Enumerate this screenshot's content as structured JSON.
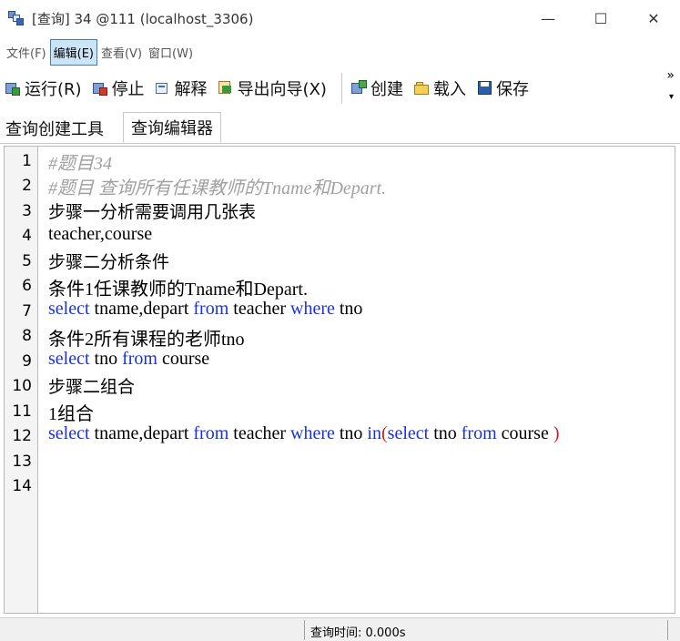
{
  "window": {
    "title": "[查询] 34 @111 (localhost_3306)",
    "minimize": "—",
    "maximize": "☐",
    "close": "✕"
  },
  "menu": {
    "file": "文件(F)",
    "edit": "编辑(E)",
    "view": "查看(V)",
    "window": "窗口(W)"
  },
  "toolbar": {
    "run": "运行(R)",
    "stop": "停止",
    "explain": "解释",
    "export_wizard": "导出向导(X)",
    "create": "创建",
    "load": "载入",
    "save": "保存",
    "overflow": "»",
    "dropdown": "▾"
  },
  "tabs": {
    "query_builder": "查询创建工具",
    "query_editor": "查询编辑器"
  },
  "editor": {
    "line_numbers": [
      "1",
      "2",
      "3",
      "4",
      "5",
      "6",
      "7",
      "8",
      "9",
      "10",
      "11",
      "12",
      "13",
      "14"
    ],
    "lines": {
      "l1": "#题目34",
      "l2": "#题目 查询所有任课教师的Tname和Depart.",
      "l3": "步骤一分析需要调用几张表",
      "l4": "teacher,course",
      "l5": "步骤二分析条件",
      "l6": "条件1任课教师的Tname和Depart.",
      "l7": {
        "k1": "select",
        "t1": " tname,depart ",
        "k2": "from",
        "t2": " teacher ",
        "k3": "where",
        "t3": " tno"
      },
      "l8": "条件2所有课程的老师tno",
      "l9": {
        "k1": "select",
        "t1": " tno ",
        "k2": "from",
        "t2": " course"
      },
      "l10": "步骤二组合",
      "l11": "1组合",
      "l12": {
        "k1": "select",
        "t1": " tname,depart ",
        "k2": "from",
        "t2": " teacher ",
        "k3": "where",
        "t3": " tno ",
        "k4": "in",
        "p1": "(",
        "k5": "select",
        "t4": " tno ",
        "k6": "from",
        "t5": " course ",
        "p2": ")"
      }
    }
  },
  "status": {
    "query_time": "查询时间: 0.000s"
  },
  "colors": {
    "keyword": "#1a33d6",
    "comment": "#a0a0a0",
    "paren": "#d11a1a",
    "menu_active_bg": "#cce4f7"
  }
}
